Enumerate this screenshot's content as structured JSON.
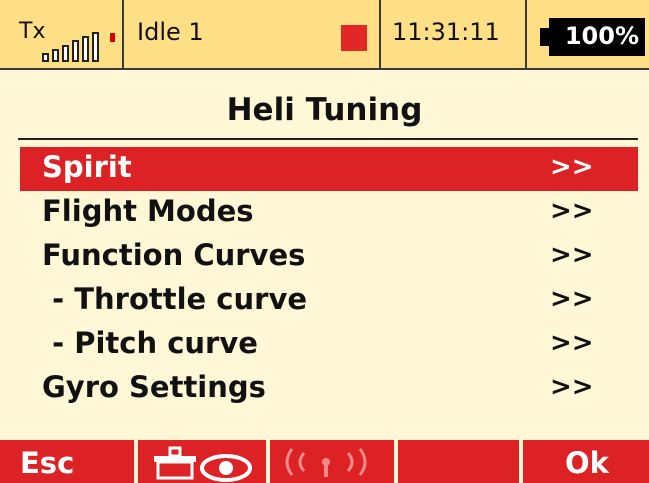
{
  "status": {
    "tx_label": "Tx",
    "model_name": "Idle 1",
    "time": "11:31:11",
    "battery": "100%",
    "icons": [
      "signal-bars-icon",
      "alarm-indicator-icon",
      "battery-icon"
    ],
    "colors": {
      "bar_bg": "#ffdf86",
      "alarm": "#e32626"
    }
  },
  "page": {
    "title": "Heli Tuning"
  },
  "menu": {
    "items": [
      {
        "label": "Spirit",
        "arrow": ">>",
        "selected": true
      },
      {
        "label": "Flight Modes",
        "arrow": ">>"
      },
      {
        "label": "Function Curves",
        "arrow": ">>"
      },
      {
        "label": " - Throttle curve",
        "arrow": ">>"
      },
      {
        "label": " - Pitch curve",
        "arrow": ">>"
      },
      {
        "label": "Gyro Settings",
        "arrow": ">>"
      }
    ],
    "colors": {
      "selected_bg": "#dd2226",
      "background": "#fff7d6"
    }
  },
  "softkeys": {
    "esc": "Esc",
    "ok": "Ok",
    "icons": [
      "trainer-eye-icon",
      "wireless-signal-icon"
    ]
  }
}
